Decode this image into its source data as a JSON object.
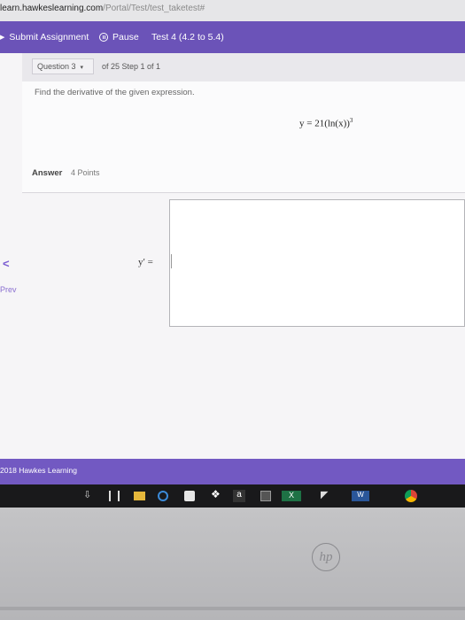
{
  "browser": {
    "url_domain": "learn.hawkeslearning.com",
    "url_path": "/Portal/Test/test_taketest#"
  },
  "toolbar": {
    "submit_label": "Submit Assignment",
    "pause_label": "Pause",
    "test_label": "Test 4 (4.2 to 5.4)"
  },
  "question": {
    "selector_label": "Question 3",
    "step_text": "of 25 Step 1 of 1",
    "prompt": "Find the derivative of the given expression.",
    "expression": "y = 21(ln(x))",
    "expression_exponent": "3"
  },
  "answer": {
    "label": "Answer",
    "points": "4 Points",
    "lhs": "y′ ="
  },
  "nav": {
    "prev_label": "Prev"
  },
  "footer": {
    "copyright": "2018 Hawkes Learning"
  },
  "taskbar": {
    "icons": [
      "download-icon",
      "task-view-icon",
      "file-explorer-icon",
      "edge-icon",
      "store-icon",
      "dropbox-icon",
      "amazon-icon",
      "calculator-icon",
      "excel-icon",
      "send-icon",
      "word-icon",
      "chrome-icon"
    ],
    "amazon_glyph": "a",
    "excel_glyph": "X",
    "word_glyph": "W"
  },
  "device": {
    "brand": "hp"
  },
  "colors": {
    "accent": "#6b53b8",
    "footer": "#7259c2",
    "prev": "#7a5bd2"
  }
}
